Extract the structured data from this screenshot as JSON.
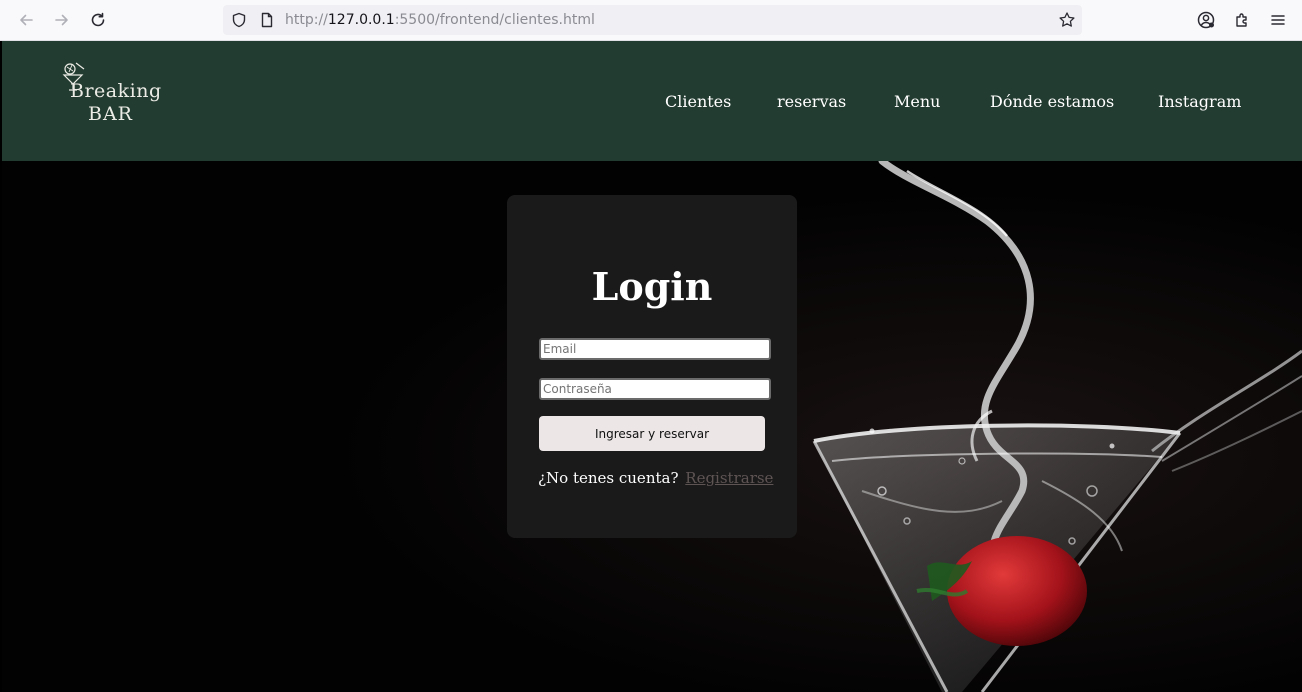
{
  "browser": {
    "url_prefix": "http://",
    "url_host": "127.0.0.1",
    "url_rest": ":5500/frontend/clientes.html"
  },
  "header": {
    "logo": {
      "line1": "Breaking",
      "line2": "BAR"
    },
    "nav": [
      "Clientes",
      "reservas",
      "Menu",
      "Dónde estamos",
      "Instagram"
    ]
  },
  "login": {
    "title": "Login",
    "email_placeholder": "Email",
    "password_placeholder": "Contraseña",
    "submit_label": "Ingresar y reservar",
    "register_prompt": "¿No tenes cuenta?",
    "register_link": "Registrarse"
  },
  "colors": {
    "header_bg": "#233c31",
    "card_bg": "#1b1a1a",
    "button_bg": "#ece6e6",
    "link": "#5e5454"
  }
}
